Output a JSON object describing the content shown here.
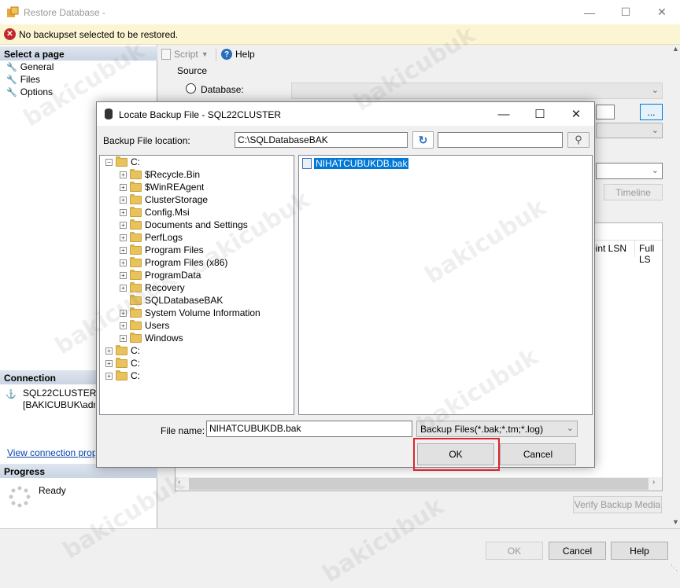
{
  "window": {
    "title": "Restore Database -",
    "error_text": "No backupset selected to be restored."
  },
  "left_pane": {
    "select_page_header": "Select a page",
    "pages": [
      {
        "label": "General",
        "icon": "wrench-icon"
      },
      {
        "label": "Files",
        "icon": "wrench-icon"
      },
      {
        "label": "Options",
        "icon": "wrench-icon"
      }
    ],
    "connection_header": "Connection",
    "server": "SQL22CLUSTER",
    "user": "[BAKICUBUK\\admin",
    "view_connection_link": "View connection proper",
    "progress_header": "Progress",
    "progress_status": "Ready"
  },
  "toolbar": {
    "script_label": "Script",
    "help_label": "Help"
  },
  "main": {
    "source_label": "Source",
    "database_label": "Database:",
    "browse_label": "...",
    "timeline_label": "Timeline",
    "col_checkpoint_lsn": "oint LSN",
    "col_full_lsn": "Full LS",
    "verify_label": "Verify Backup Media"
  },
  "dialog": {
    "title": "Locate Backup File - SQL22CLUSTER",
    "backup_location_label": "Backup File location:",
    "backup_location_value": "C:\\SQLDatabaseBAK",
    "search_value": "",
    "tree": {
      "root": "C:",
      "children": [
        "$Recycle.Bin",
        "$WinREAgent",
        "ClusterStorage",
        "Config.Msi",
        "Documents and Settings",
        "PerfLogs",
        "Program Files",
        "Program Files (x86)",
        "ProgramData",
        "Recovery",
        "SQLDatabaseBAK",
        "System Volume Information",
        "Users",
        "Windows"
      ],
      "other_drives": [
        "C:",
        "C:",
        "C:"
      ]
    },
    "files": [
      "NIHATCUBUKDB.bak"
    ],
    "file_name_label": "File name:",
    "file_name_value": "NIHATCUBUKDB.bak",
    "file_type_value": "Backup Files(*.bak;*.tm;*.log)",
    "ok_label": "OK",
    "cancel_label": "Cancel"
  },
  "bottom": {
    "ok_label": "OK",
    "cancel_label": "Cancel",
    "help_label": "Help"
  },
  "watermark": "bakicubuk"
}
